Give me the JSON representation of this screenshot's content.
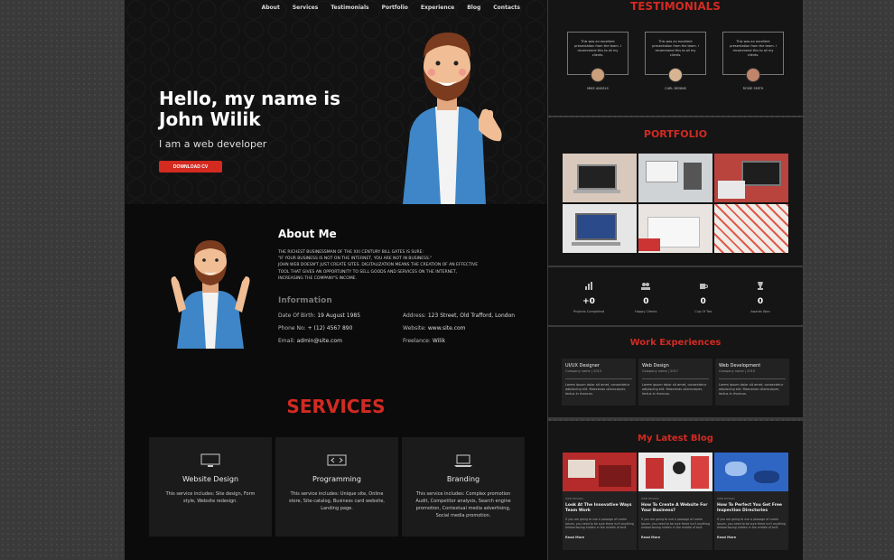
{
  "nav": [
    "About",
    "Services",
    "Testimonials",
    "Portfolio",
    "Experience",
    "Blog",
    "Contacts"
  ],
  "hero": {
    "title": "Hello, my name is John Wilik",
    "subtitle": "I am a web developer",
    "button": "DOWNLOAD CV"
  },
  "about": {
    "title": "About Me",
    "lines": [
      "THE RICHEST BUSINESSMAN OF THE XXI CENTURY BILL GATES IS SURE:",
      "\"IF YOUR BUSINESS IS NOT ON THE INTERNET, YOU ARE NOT IN BUSINESS.\"",
      "JOHN WEB DOESN'T JUST CREATE SITES. DIGITALIZATION MEANS THE CREATION OF AN EFFECTIVE",
      "TOOL THAT GIVES AN OPPORTUNITY TO SELL GOODS AND SERVICES ON THE INTERNET,",
      "INCREASING THE COMPANY'S INCOME."
    ],
    "info_title": "Information",
    "info": [
      {
        "label": "Date Of Birth:",
        "value": "19 August 1985"
      },
      {
        "label": "Address:",
        "value": "123 Street, Old Trafford, London"
      },
      {
        "label": "Phone No:",
        "value": "+ (12) 4567 890"
      },
      {
        "label": "Website:",
        "value": "www.site.com"
      },
      {
        "label": "Email:",
        "value": "admin@site.com"
      },
      {
        "label": "Freelance:",
        "value": "Wilik"
      }
    ]
  },
  "services": {
    "title": "SERVICES",
    "items": [
      {
        "name": "Website Design",
        "desc": "This service includes: Site design, Form style, Website redesign.",
        "icon": "monitor-icon"
      },
      {
        "name": "Programming",
        "desc": "This service includes: Unique site, Online store, Site-catalog, Business card website, Landing page.",
        "icon": "code-icon"
      },
      {
        "name": "Branding",
        "desc": "This service includes: Complex promotion Audit, Competitor analysis, Search engine promotion, Contextual media advertising, Social media promotion.",
        "icon": "laptop-icon"
      }
    ]
  },
  "testimonials": {
    "title": "TESTIMONIALS",
    "items": [
      {
        "quote": "This was an excellent presentation from the team. I recommend this to all my clients.",
        "name": "MIKE ANGELS"
      },
      {
        "quote": "This was an excellent presentation from the team. I recommend this to all my clients.",
        "name": "CARL DENNIS"
      },
      {
        "quote": "This was an excellent presentation from the team. I recommend this to all my clients.",
        "name": "ROSIE SMITH"
      }
    ]
  },
  "portfolio": {
    "title": "PORTFOLIO"
  },
  "stats": [
    {
      "num": "+0",
      "label": "Projects Completed",
      "icon": "chart-icon"
    },
    {
      "num": "0",
      "label": "Happy Clients",
      "icon": "users-icon"
    },
    {
      "num": "0",
      "label": "Cup Of Tea",
      "icon": "cup-icon"
    },
    {
      "num": "0",
      "label": "Awards Won",
      "icon": "trophy-icon"
    }
  ],
  "work": {
    "title": "Work Experiences",
    "items": [
      {
        "title": "UI/UX Designer",
        "sub": "Company name | 2015",
        "desc": "Lorem ipsum dolor sit amet, consectetur adipiscing elit. Maecenas ullamcorper, lectus in rhoncus."
      },
      {
        "title": "Web Design",
        "sub": "Company name | 2017",
        "desc": "Lorem ipsum dolor sit amet, consectetur adipiscing elit. Maecenas ullamcorper, lectus in rhoncus."
      },
      {
        "title": "Web Development",
        "sub": "Company name | 2019",
        "desc": "Lorem ipsum dolor sit amet, consectetur adipiscing elit. Maecenas ullamcorper, lectus in rhoncus."
      }
    ]
  },
  "blog": {
    "title": "My Latest Blog",
    "items": [
      {
        "tag": "WEB DESIGN",
        "title": "Look At The Innovative Ways Team Work",
        "desc": "If you are going to use a passage of Lorem Ipsum, you need to be sure there isn't anything embarrassing hidden in the middle of text.",
        "more": "Read More"
      },
      {
        "tag": "WEB DESIGN",
        "title": "How To Create A Website For Your Business?",
        "desc": "If you are going to use a passage of Lorem Ipsum, you need to be sure there isn't anything embarrassing hidden in the middle of text.",
        "more": "Read More"
      },
      {
        "tag": "WEB DESIGN",
        "title": "How To Perfect You Get Free Inspection Directories",
        "desc": "If you are going to use a passage of Lorem Ipsum, you need to be sure there isn't anything embarrassing hidden in the middle of text.",
        "more": "Read More"
      }
    ]
  }
}
